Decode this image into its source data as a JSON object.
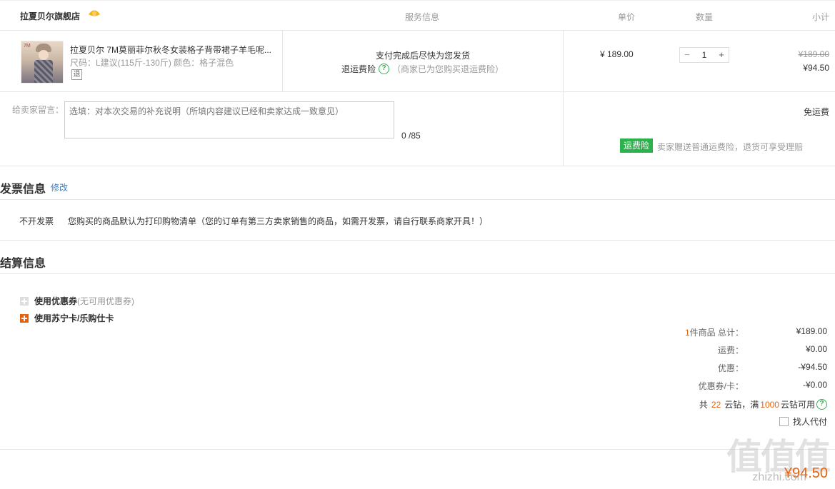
{
  "header": {
    "store_name": "拉夏贝尔旗舰店",
    "col_service": "服务信息",
    "col_unit_price": "单价",
    "col_quantity": "数量",
    "col_subtotal": "小计"
  },
  "product": {
    "title": "拉夏贝尔 7M莫丽菲尔秋冬女装格子背带裙子羊毛呢...",
    "spec": "尺码：L建议(115斤-130斤)    颜色：格子混色",
    "return_badge": "退",
    "thumb_tag": "7M",
    "service_line1": "支付完成后尽快为您发货",
    "service_insurance": "退运费险",
    "service_note": "（商家已为您购买退运费险）",
    "unit_price": "¥ 189.00",
    "quantity": "1",
    "original_price": "¥189.00",
    "subtotal": "¥94.50"
  },
  "message": {
    "label": "给卖家留言：",
    "placeholder": "选填：对本次交易的补充说明（所填内容建议已经和卖家达成一致意见）",
    "count": "0 /85",
    "shipping": "免运费",
    "insurance_tag": "运费险",
    "insurance_text": "卖家赠送普通运费险，退货可享受理赔"
  },
  "invoice": {
    "title": "发票信息",
    "edit": "修改",
    "type": "不开发票",
    "note": "您购买的商品默认为打印购物清单（您的订单有第三方卖家销售的商品，如需开发票，请自行联系商家开具！）"
  },
  "settlement": {
    "title": "结算信息",
    "coupon_label": "使用优惠券",
    "coupon_note": "(无可用优惠券)",
    "card_label": "使用苏宁卡/乐购仕卡",
    "item_count": "1",
    "item_count_suffix": "件商品 总计：",
    "total_goods": "¥189.00",
    "freight_label": "运费：",
    "freight": "¥0.00",
    "discount_label": "优惠：",
    "discount": "-¥94.50",
    "voucher_label": "优惠券/卡：",
    "voucher": "-¥0.00",
    "coin_prefix": "共",
    "coin_count": "22",
    "coin_mid": "云钻，满",
    "coin_threshold": "1000",
    "coin_suffix": "云钻可用",
    "agent_pay": "找人代付",
    "payable": "¥94.50"
  },
  "watermark": {
    "logo": "值值值",
    "text": "zhizhi.com"
  },
  "colors": {
    "accent_orange": "#e8620b",
    "green": "#2bb24c",
    "link_blue": "#3b7fc4"
  }
}
